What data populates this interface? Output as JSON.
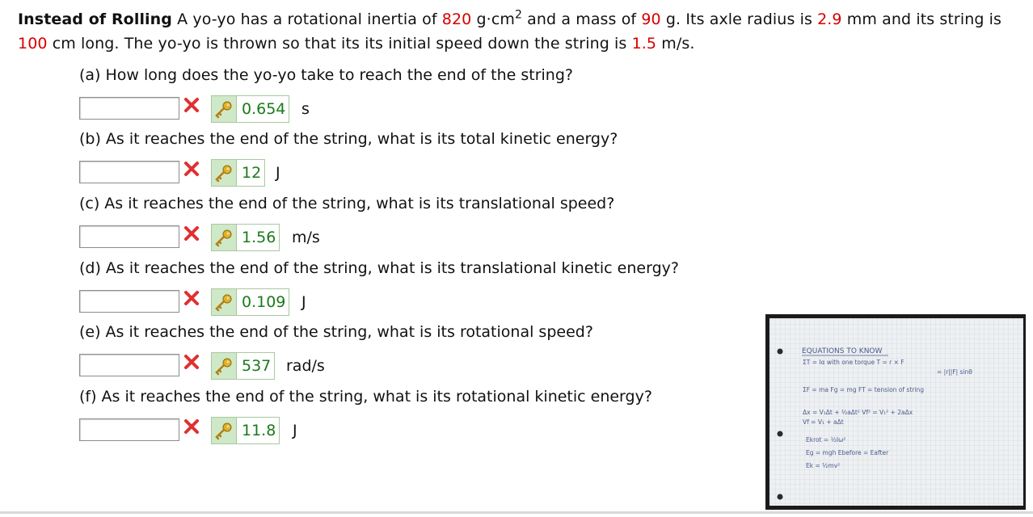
{
  "problem": {
    "title": "Instead of Rolling",
    "t1": " A yo-yo has a rotational inertia of ",
    "inertia": "820",
    "t2": " g·cm",
    "inertia_exp": "2",
    "t3": " and a mass of ",
    "mass": "90",
    "t4": " g. Its axle radius is ",
    "radius": "2.9",
    "t5": " mm and its string is ",
    "length": "100",
    "t6": " cm long. The yo-yo is thrown so that its its initial speed down the string is ",
    "speed": "1.5",
    "t7": " m/s."
  },
  "parts": [
    {
      "question": "(a) How long does the yo-yo take to reach the end of the string?",
      "answer": "0.654",
      "unit": "s"
    },
    {
      "question": "(b) As it reaches the end of the string, what is its total kinetic energy?",
      "answer": "12",
      "unit": "J"
    },
    {
      "question": "(c) As it reaches the end of the string, what is its translational speed?",
      "answer": "1.56",
      "unit": "m/s"
    },
    {
      "question": "(d) As it reaches the end of the string, what is its translational kinetic energy?",
      "answer": "0.109",
      "unit": "J"
    },
    {
      "question": "(e) As it reaches the end of the string, what is its rotational speed?",
      "answer": "537",
      "unit": "rad/s"
    },
    {
      "question": "(f) As it reaches the end of the string, what is its rotational kinetic energy?",
      "answer": "11.8",
      "unit": "J"
    }
  ],
  "notes": {
    "heading": "EQUATIONS TO KNOW",
    "lines": [
      "ΣT = Iα      with one torque  T = r × F",
      "= |r||F| sinθ",
      "ΣF = ma      Fg = mg    FT = tension of string",
      "Δx = V₁Δt + ½aΔt²       Vf² = V₁² + 2aΔx",
      "Vf = V₁ + aΔt",
      "Ekrot = ½Iω²",
      "Eg = mgh              Ebefore = Eafter",
      "Ek = ½mv²"
    ]
  },
  "colors": {
    "given_value": "#d40000",
    "correct_answer": "#1a7a1a",
    "wrong_icon": "#e03030"
  },
  "icons": {
    "wrong": "red-x-icon",
    "key": "key-icon"
  }
}
